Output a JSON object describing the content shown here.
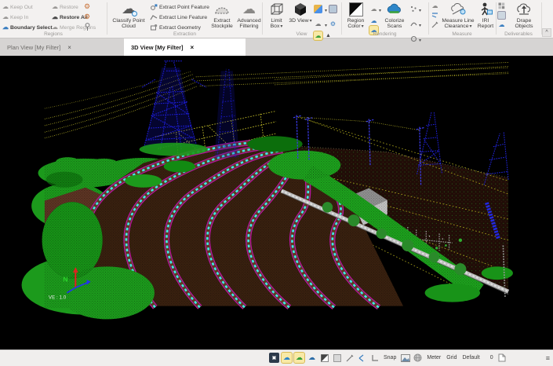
{
  "icons": {
    "cloud": "☁",
    "gear": "⚙",
    "close": "×",
    "collapse": "^",
    "hamburger": "≡"
  },
  "ribbon": {
    "groups": {
      "regions": {
        "label": "Regions",
        "keep_out": "Keep Out",
        "keep_in": "Keep In",
        "boundary_select": "Boundary Select",
        "restore": "Restore",
        "restore_all": "Restore All",
        "merge_regions": "Merge Regions"
      },
      "extraction": {
        "label": "Extraction",
        "classify_point_cloud": "Classify Point Cloud",
        "extract_point_feature": "Extract Point Feature",
        "extract_line_feature": "Extract Line Feature",
        "extract_geometry": "Extract Geometry",
        "extract_stockpile": "Extract Stockpile",
        "advanced_filtering": "Advanced Filtering"
      },
      "view": {
        "label": "View",
        "limit_box": "Limit Box",
        "view_3d": "3D View"
      },
      "rendering": {
        "label": "Rendering",
        "region_color": "Region Color",
        "colorize_scans": "Colorize Scans"
      },
      "measure": {
        "label": "Measure",
        "measure_line_clearance": "Measure Line Clearance",
        "iri_report": "IRI Report"
      },
      "deliverables": {
        "label": "Deliverables",
        "drape_objects": "Drape Objects"
      }
    }
  },
  "tabs": [
    {
      "label": "Plan View [My Filter]",
      "active": false
    },
    {
      "label": "3D View [My Filter]",
      "active": true
    }
  ],
  "viewport": {
    "ve_label": "VE : 1.0",
    "north_label": "N"
  },
  "statusbar": {
    "snap": "Snap",
    "meter": "Meter",
    "grid": "Grid",
    "default": "Default",
    "value": "0"
  },
  "colors": {
    "tower_blue": "#1d1dd8",
    "rail_magenta": "#b515a0",
    "tie_cyan": "#40e8e8",
    "vegetation_green": "#1c9a1c",
    "ground_brown": "#5c3423",
    "wire_yellow": "#c9c32a",
    "wall_gray": "#bdbdbd",
    "highlight_yellow": "#f8e9a6"
  }
}
